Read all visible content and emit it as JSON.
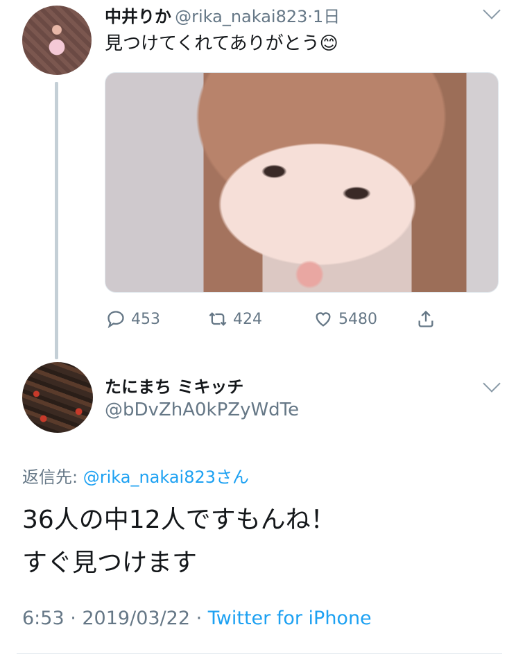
{
  "tweet_top": {
    "name": "中井りか",
    "handle": "@rika_nakai823",
    "separator": "·",
    "time": "1日",
    "text": "見つけてくれてありがとう",
    "emoji": "😊",
    "actions": {
      "reply_count": "453",
      "retweet_count": "424",
      "like_count": "5480"
    }
  },
  "tweet_reply": {
    "name": "たにまち ミキッチ",
    "handle": "@bDvZhA0kPZyWdTe",
    "reply_to_prefix": "返信先: ",
    "reply_to_handle": "@rika_nakai823さん",
    "text_line1": "36人の中12人ですもんね！",
    "text_line2": "すぐ見つけます",
    "timestamp": "6:53 · 2019/03/22 · ",
    "source": "Twitter for iPhone"
  },
  "colors": {
    "accent": "#1da1f2",
    "secondary_text": "#657786",
    "primary_text": "#14171a"
  }
}
